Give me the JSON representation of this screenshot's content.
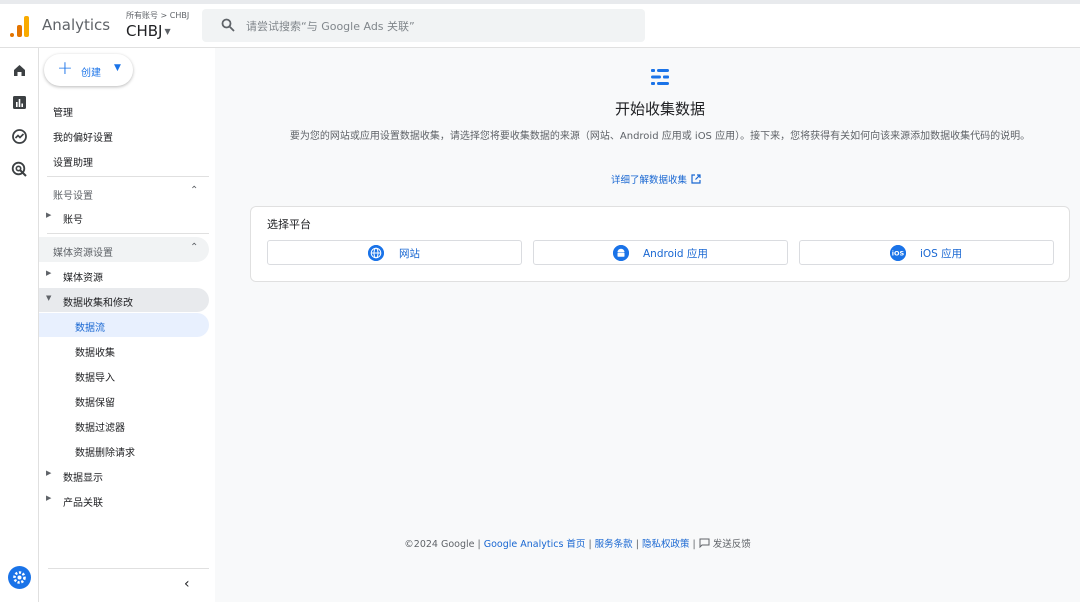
{
  "header": {
    "app_name": "Analytics",
    "breadcrumb": "所有账号 > CHBJ",
    "account": "CHBJ",
    "search_placeholder": "请尝试搜索“与 Google Ads 关联”"
  },
  "rail": {
    "icons": [
      "home-icon",
      "reports-icon",
      "explore-icon",
      "advertising-icon",
      "settings-icon"
    ]
  },
  "sidebar": {
    "create_label": "创建",
    "top_items": [
      "管理",
      "我的偏好设置",
      "设置助理"
    ],
    "account_section": {
      "title": "账号设置",
      "items": [
        "账号"
      ]
    },
    "property_section": {
      "title": "媒体资源设置",
      "items": [
        "媒体资源",
        "数据收集和修改"
      ],
      "sub_items": [
        "数据流",
        "数据收集",
        "数据导入",
        "数据保留",
        "数据过滤器",
        "数据删除请求"
      ],
      "more_items": [
        "数据显示",
        "产品关联"
      ]
    }
  },
  "main": {
    "title": "开始收集数据",
    "description": "要为您的网站或应用设置数据收集，请选择您将要收集数据的来源（网站、Android 应用或 iOS 应用）。接下来，您将获得有关如何向该来源添加数据收集代码的说明。",
    "learn_more": "详细了解数据收集",
    "platform_title": "选择平台",
    "platforms": [
      {
        "label": "网站",
        "icon": "globe-icon"
      },
      {
        "label": "Android 应用",
        "icon": "android-icon"
      },
      {
        "label": "iOS 应用",
        "icon": "ios-icon"
      }
    ]
  },
  "footer": {
    "copyright": "©2024 Google",
    "sep": " | ",
    "links": [
      "Google Analytics 首页",
      "服务条款",
      "隐私权政策"
    ],
    "feedback": "发送反馈"
  },
  "colors": {
    "accent": "#1a73e8",
    "logo_orange": "#e37400",
    "logo_yellow": "#f9ab00"
  }
}
